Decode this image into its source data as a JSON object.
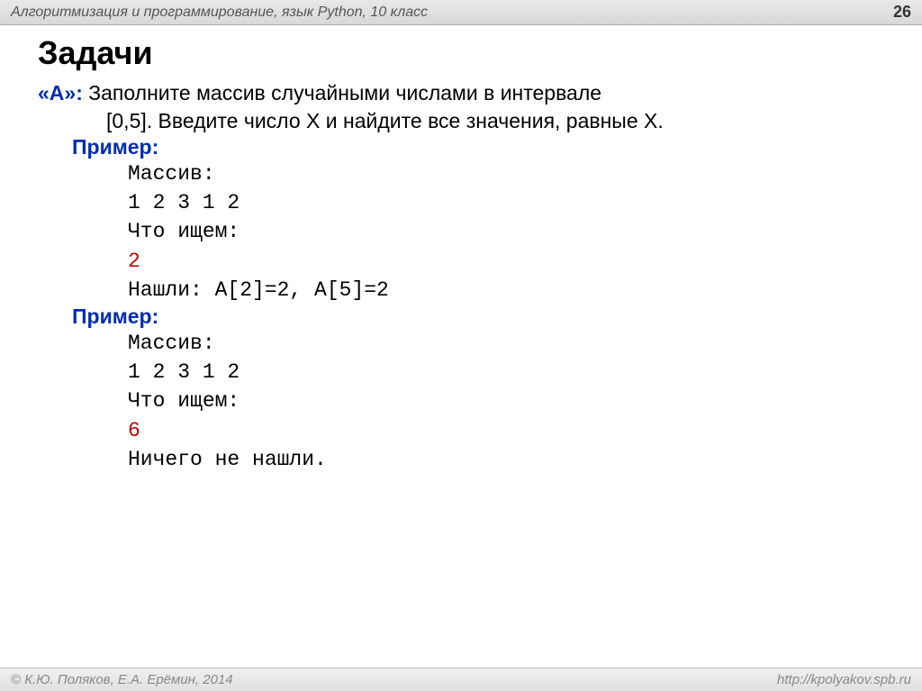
{
  "header": {
    "title": "Алгоритмизация и программирование, язык Python, 10 класс",
    "pageNumber": "26"
  },
  "mainTitle": "Задачи",
  "task": {
    "label": "«А»:",
    "line1": " Заполните массив случайными числами в интервале",
    "line2": "[0,5]. Введите число X и найдите все значения, равные X."
  },
  "example1": {
    "label": "Пример:",
    "arrayLabel": "Массив:",
    "arrayValues": "1 2 3 1 2",
    "searchLabel": "Что ищем:",
    "searchValue": "2",
    "result": "Нашли: A[2]=2, A[5]=2"
  },
  "example2": {
    "label": "Пример:",
    "arrayLabel": "Массив:",
    "arrayValues": "1 2 3 1 2",
    "searchLabel": "Что ищем:",
    "searchValue": "6",
    "result": "Ничего не нашли."
  },
  "footer": {
    "copyright": "© К.Ю. Поляков, Е.А. Ерёмин, 2014",
    "url": "http://kpolyakov.spb.ru"
  }
}
